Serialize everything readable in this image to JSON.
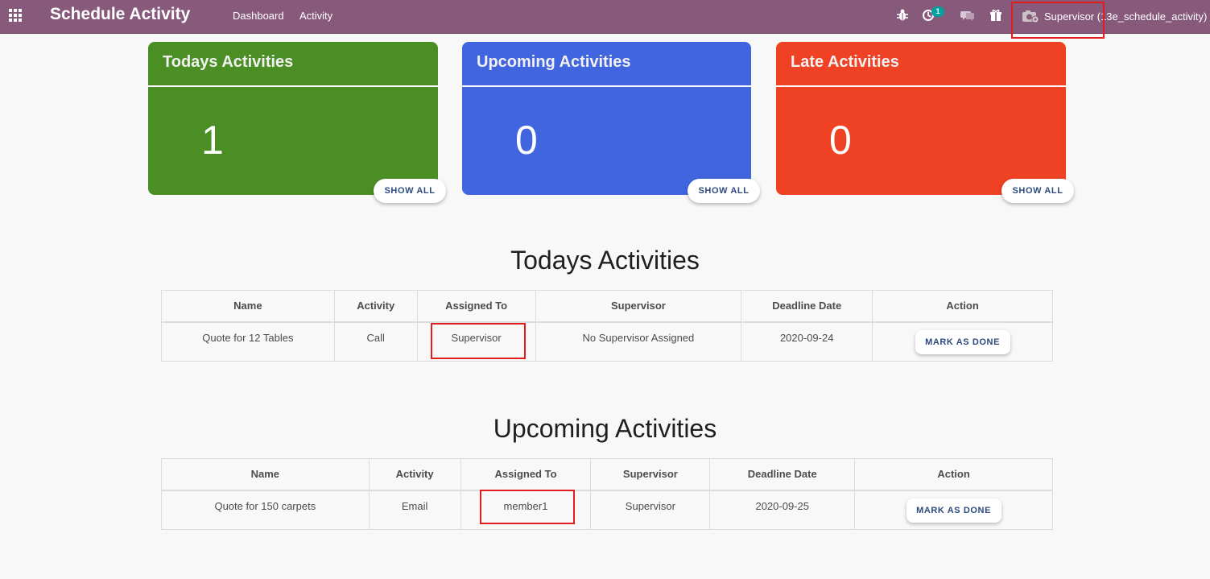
{
  "navbar": {
    "app_title": "Schedule Activity",
    "menu": [
      "Dashboard",
      "Activity"
    ],
    "activity_badge": "1",
    "user": "Supervisor (13e_schedule_activity)",
    "icons": [
      "apps-icon",
      "bug-icon",
      "clock-icon",
      "chat-icon",
      "gift-icon",
      "camera-avatar-icon"
    ]
  },
  "cards": [
    {
      "title": "Todays Activities",
      "count": "1",
      "button": "SHOW ALL",
      "color": "#4b8f24"
    },
    {
      "title": "Upcoming Activities",
      "count": "0",
      "button": "SHOW ALL",
      "color": "#4165de"
    },
    {
      "title": "Late Activities",
      "count": "0",
      "button": "SHOW ALL",
      "color": "#ef4123"
    }
  ],
  "today_section": {
    "heading": "Todays Activities",
    "columns": [
      "Name",
      "Activity",
      "Assigned To",
      "Supervisor",
      "Deadline Date",
      "Action"
    ],
    "rows": [
      {
        "name": "Quote for 12 Tables",
        "activity": "Call",
        "assigned_to": "Supervisor",
        "supervisor": "No Supervisor Assigned",
        "deadline": "2020-09-24",
        "action": "MARK AS DONE"
      }
    ]
  },
  "upcoming_section": {
    "heading": "Upcoming Activities",
    "columns": [
      "Name",
      "Activity",
      "Assigned To",
      "Supervisor",
      "Deadline Date",
      "Action"
    ],
    "rows": [
      {
        "name": "Quote for 150 carpets",
        "activity": "Email",
        "assigned_to": "member1",
        "supervisor": "Supervisor",
        "deadline": "2020-09-25",
        "action": "MARK AS DONE"
      }
    ]
  },
  "highlight_color": "#e11d1d"
}
